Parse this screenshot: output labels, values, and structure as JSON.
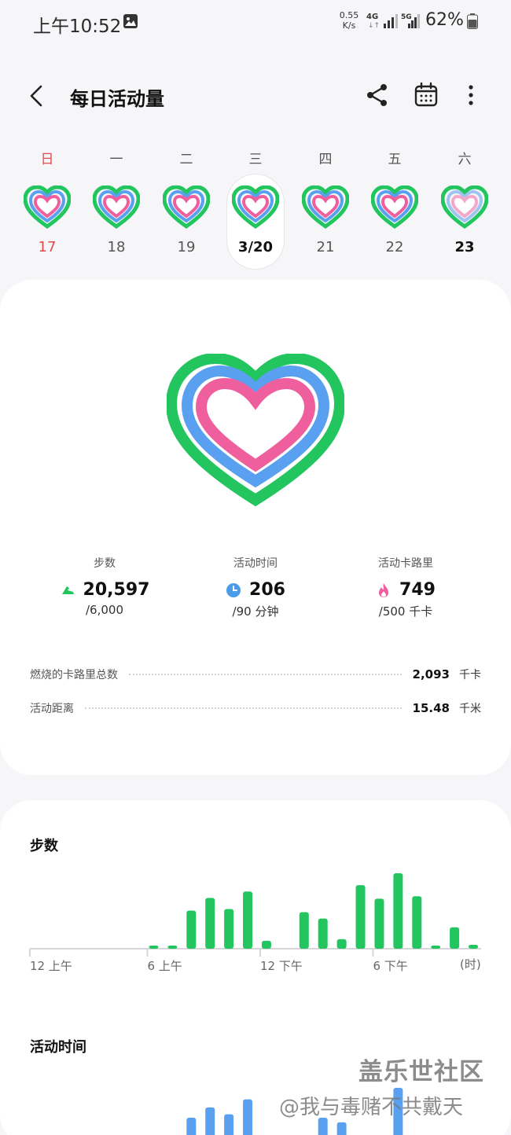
{
  "status_bar": {
    "time": "上午10:52",
    "net_speed_value": "0.55",
    "net_speed_unit": "K/s",
    "network_4g": "4G",
    "network_5g": "5G",
    "battery": "62%"
  },
  "header": {
    "title": "每日活动量"
  },
  "week": {
    "days": [
      {
        "weekday": "日",
        "date": "17"
      },
      {
        "weekday": "一",
        "date": "18"
      },
      {
        "weekday": "二",
        "date": "19"
      },
      {
        "weekday": "三",
        "date": "3/20"
      },
      {
        "weekday": "四",
        "date": "21"
      },
      {
        "weekday": "五",
        "date": "22"
      },
      {
        "weekday": "六",
        "date": "23"
      }
    ]
  },
  "summary": {
    "steps": {
      "label": "步数",
      "value": "20,597",
      "goal": "/6,000"
    },
    "active_time": {
      "label": "活动时间",
      "value": "206",
      "goal": "/90 分钟"
    },
    "active_calories": {
      "label": "活动卡路里",
      "value": "749",
      "goal": "/500 千卡"
    },
    "details": [
      {
        "label": "燃烧的卡路里总数",
        "value": "2,093",
        "unit": "千卡"
      },
      {
        "label": "活动距离",
        "value": "15.48",
        "unit": "千米"
      }
    ]
  },
  "steps_chart": {
    "title": "步数"
  },
  "active_time_section": {
    "title": "活动时间"
  },
  "chart_data": [
    {
      "type": "bar",
      "title": "步数",
      "x_ticks": [
        "12 上午",
        "6 上午",
        "12 下午",
        "6 下午",
        "(时)"
      ],
      "hours": [
        0,
        1,
        2,
        3,
        4,
        5,
        6,
        7,
        8,
        9,
        10,
        11,
        12,
        13,
        14,
        15,
        16,
        17,
        18,
        19,
        20,
        21,
        22,
        23
      ],
      "values": [
        0,
        0,
        0,
        0,
        0,
        0,
        4,
        4,
        48,
        64,
        50,
        72,
        10,
        0,
        46,
        38,
        12,
        80,
        63,
        95,
        66,
        4,
        27,
        5
      ],
      "color": "#22c55e",
      "grid": false
    },
    {
      "type": "bar",
      "title": "活动时间",
      "hours": [
        8,
        9,
        10,
        11,
        15,
        16,
        19
      ],
      "values": [
        30,
        48,
        36,
        62,
        30,
        22,
        82
      ],
      "color": "#5aa0f0",
      "partial": true
    }
  ],
  "watermark": {
    "line1": "盖乐世社区",
    "line2": "@我与毒赌不共戴天"
  },
  "colors": {
    "green": "#22c55e",
    "blue": "#5aa0f0",
    "pink": "#ef5f9d",
    "sunday_red": "#e14a4a"
  }
}
